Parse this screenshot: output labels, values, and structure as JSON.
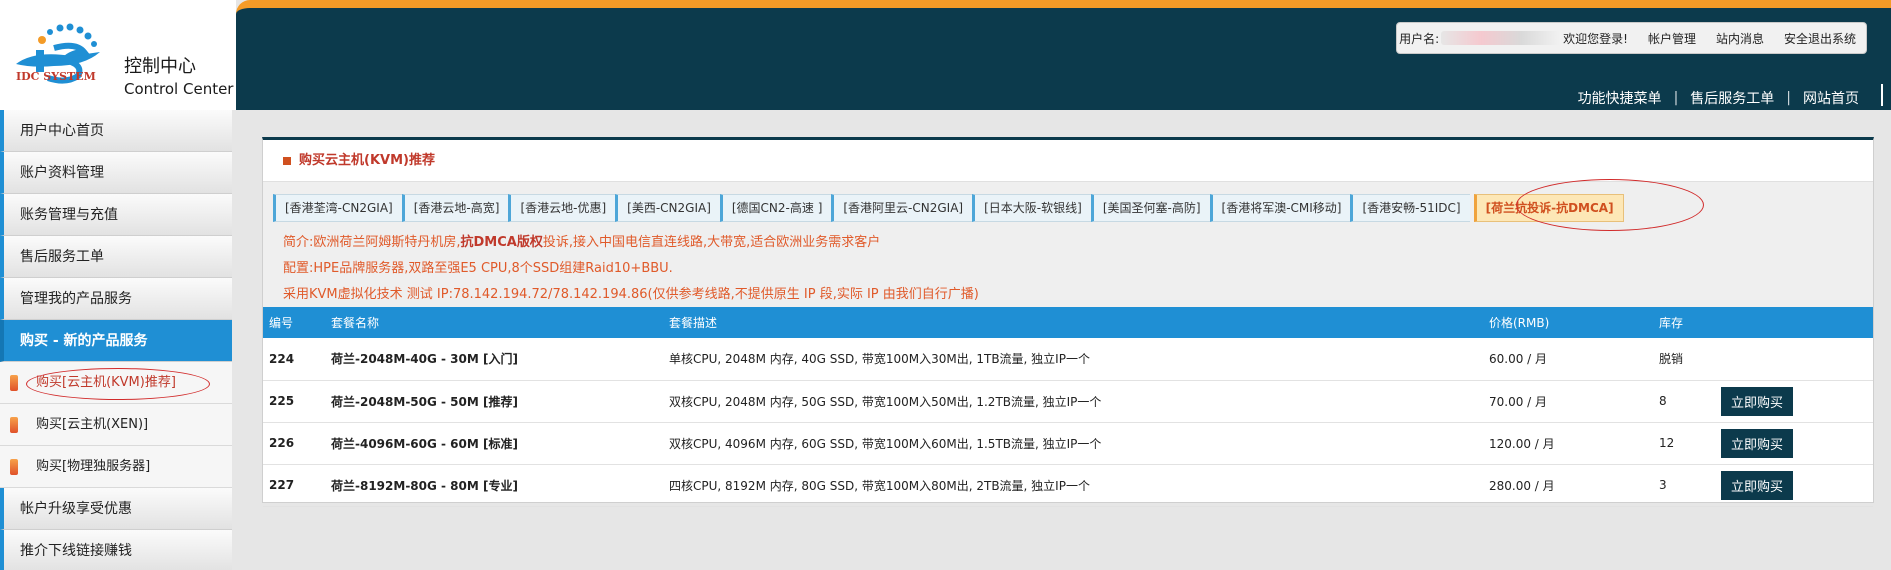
{
  "brand": {
    "title_cn": "控制中心",
    "title_en": "Control Center",
    "logo_text": "IDC SYSTEM",
    "header_color": "#0c3a4c",
    "accent_orange": "#f49b27",
    "accent_blue": "#1f8fd4"
  },
  "userbar": {
    "prefix": "用户名:",
    "welcome": "欢迎您登录!",
    "links": [
      "帐户管理",
      "站内消息",
      "安全退出系统"
    ]
  },
  "topnav": [
    "功能快捷菜单",
    "售后服务工单",
    "网站首页"
  ],
  "sidebar": {
    "items": [
      {
        "label": "用户中心首页"
      },
      {
        "label": "账户资料管理"
      },
      {
        "label": "账务管理与充值"
      },
      {
        "label": "售后服务工单"
      },
      {
        "label": "管理我的产品服务"
      },
      {
        "label": "购买 - 新的产品服务"
      }
    ],
    "subitems": [
      {
        "label": "购买[云主机(KVM)推荐]"
      },
      {
        "label": "购买[云主机(XEN)]"
      },
      {
        "label": "购买[物理独服务器]"
      }
    ],
    "bottom_items": [
      {
        "label": "帐户升级享受优惠"
      },
      {
        "label": "推介下线链接赚钱"
      }
    ]
  },
  "panel": {
    "title": "购买云主机(KVM)推荐",
    "tabs": [
      "[香港荃湾-CN2GIA]",
      "[香港云地-高宽]",
      "[香港云地-优惠]",
      "[美西-CN2GIA]",
      "[德国CN2-高速 ]",
      "[香港阿里云-CN2GIA]",
      "[日本大阪-软银线]",
      "[美国圣何塞-高防]",
      "[香港将军澳-CMI移动]",
      "[香港安畅-51IDC]",
      "[荷兰抗投诉-抗DMCA]"
    ],
    "desc": {
      "line1_a": "简介:欧洲荷兰阿姆斯特丹机房,",
      "line1_b": "抗DMCA版权",
      "line1_c": "投诉,接入中国电信直连线路,大带宽,适合欧洲业务需求客户",
      "line2": "配置:HPE品牌服务器,双路至强E5 CPU,8个SSD组建Raid10+BBU.",
      "line3": "采用KVM虚拟化技术 测试 IP:78.142.194.72/78.142.194.86(仅供参考线路,不提供原生 IP 段,实际 IP 由我们自行广播)"
    },
    "table": {
      "headers": [
        "编号",
        "套餐名称",
        "套餐描述",
        "价格(RMB)",
        "库存",
        ""
      ],
      "buy_label": "立即购买",
      "rows": [
        {
          "id": "224",
          "name": "荷兰-2048M-40G - 30M [入门]",
          "desc": "单核CPU, 2048M 内存, 40G SSD, 带宽100M入30M出, 1TB流量, 独立IP一个",
          "price": "60.00 / 月",
          "stock": "脱销"
        },
        {
          "id": "225",
          "name": "荷兰-2048M-50G - 50M [推荐]",
          "desc": "双核CPU, 2048M 内存, 50G SSD, 带宽100M入50M出, 1.2TB流量, 独立IP一个",
          "price": "70.00 / 月",
          "stock": "8"
        },
        {
          "id": "226",
          "name": "荷兰-4096M-60G - 60M [标准]",
          "desc": "双核CPU, 4096M 内存, 60G SSD, 带宽100M入60M出, 1.5TB流量, 独立IP一个",
          "price": "120.00 / 月",
          "stock": "12"
        },
        {
          "id": "227",
          "name": "荷兰-8192M-80G - 80M [专业]",
          "desc": "四核CPU, 8192M 内存, 80G SSD, 带宽100M入80M出, 2TB流量, 独立IP一个",
          "price": "280.00 / 月",
          "stock": "3"
        }
      ]
    }
  }
}
